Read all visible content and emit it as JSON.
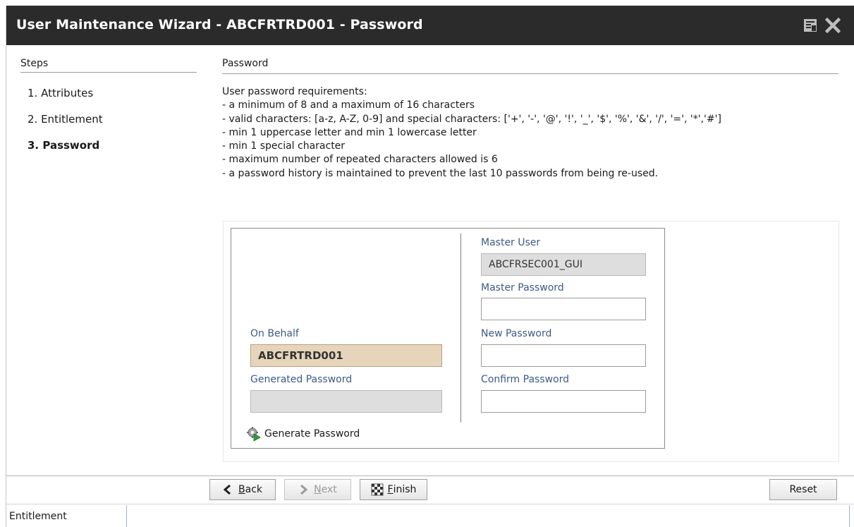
{
  "window": {
    "title": "User Maintenance Wizard  - ABCFRTRD001 - Password",
    "restore_icon": "restore-icon",
    "close_icon": "close-icon"
  },
  "steps": {
    "heading": "Steps",
    "items": [
      {
        "label": "1. Attributes",
        "active": false
      },
      {
        "label": "2. Entitlement",
        "active": false
      },
      {
        "label": "3. Password",
        "active": true
      }
    ]
  },
  "section": {
    "heading": "Password",
    "requirements": [
      "User password requirements:",
      "- a minimum of 8 and a maximum of 16 characters",
      "- valid characters: [a-z, A-Z, 0-9] and special characters: ['+', '-', '@', '!', '_', '$', '%', '&', '/', '=', '*','#']",
      "- min 1 uppercase letter and min 1 lowercase letter",
      "- min 1 special character",
      "- maximum number of repeated characters allowed is 6",
      "- a password history is maintained to prevent the last 10 passwords from being re-used."
    ]
  },
  "form": {
    "on_behalf_label": "On Behalf",
    "on_behalf_value": "ABCFRTRD001",
    "generated_password_label": "Generated Password",
    "generated_password_value": "",
    "generate_button_label": "Generate Password",
    "master_user_label": "Master User",
    "master_user_value": "ABCFRSEC001_GUI",
    "master_password_label": "Master Password",
    "master_password_value": "",
    "new_password_label": "New Password",
    "new_password_value": "",
    "confirm_password_label": "Confirm Password",
    "confirm_password_value": ""
  },
  "buttons": {
    "back_underlined": "B",
    "back_rest": "ack",
    "next_underlined": "N",
    "next_rest": "ext",
    "finish_underlined": "F",
    "finish_rest": "inish",
    "reset": "Reset"
  },
  "status": {
    "text": "Entitlement"
  }
}
